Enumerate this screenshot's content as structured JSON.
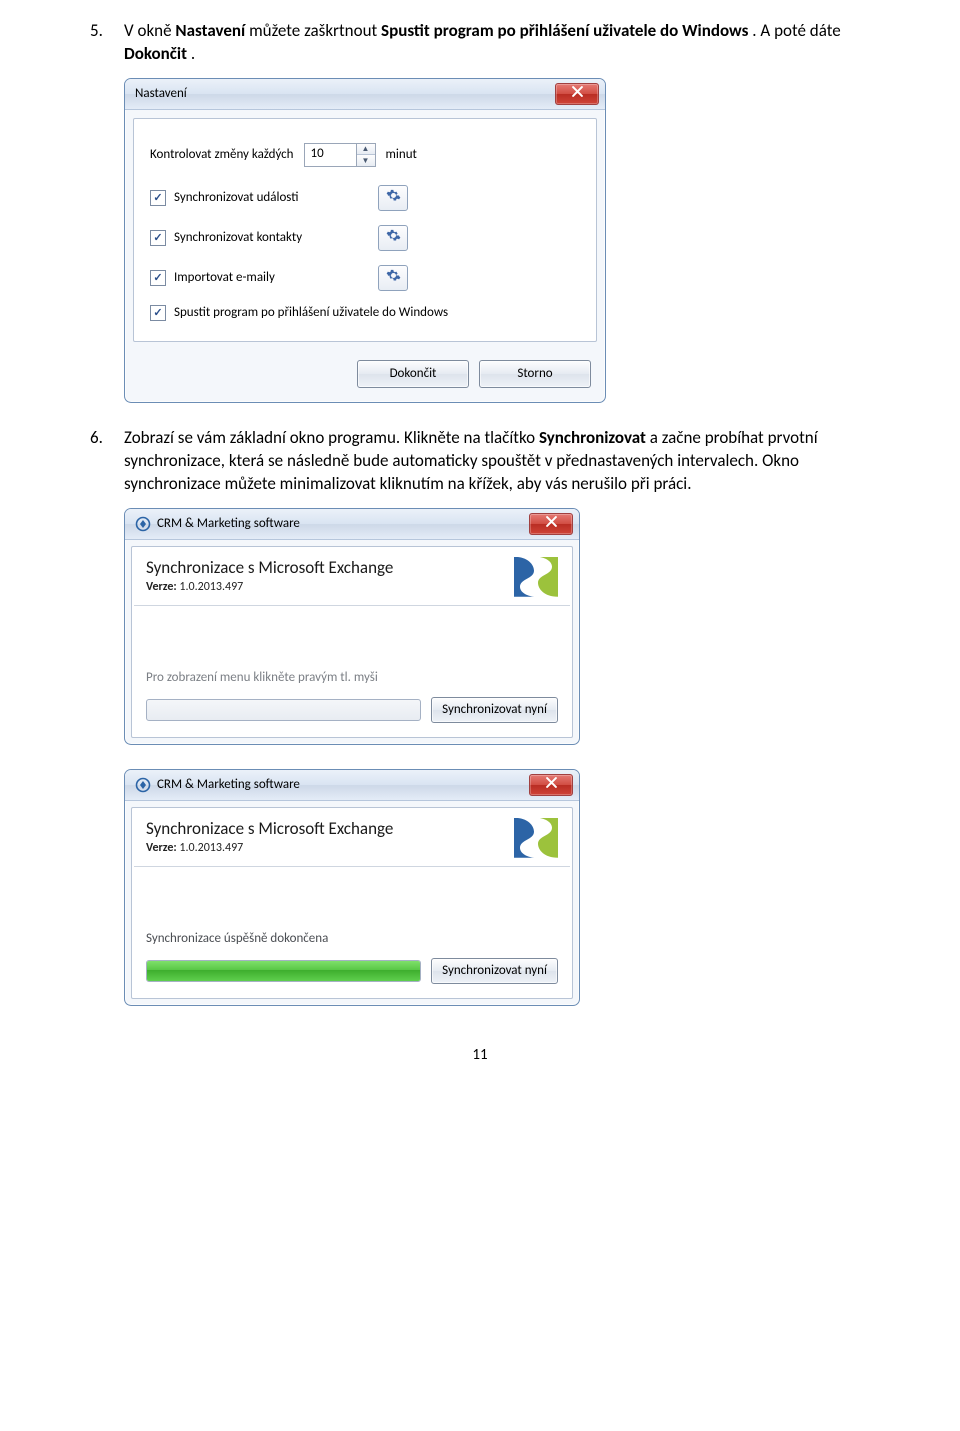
{
  "step5": {
    "num": "5.",
    "prefix": "V okně ",
    "bold1": "Nastavení",
    "mid": " můžete zaškrtnout ",
    "bold2": "Spustit program po přihlášení uživatele do Windows",
    "suffix1": ". A poté dáte ",
    "bold3": "Dokončit",
    "suffix2": "."
  },
  "dlg1": {
    "title": "Nastavení",
    "interval_prefix": "Kontrolovat změny každých",
    "interval_value": "10",
    "interval_suffix": "minut",
    "chk1": "Synchronizovat události",
    "chk2": "Synchronizovat kontakty",
    "chk3": "Importovat e-maily",
    "chk4": "Spustit program po přihlášení uživatele do Windows",
    "btn_finish": "Dokončit",
    "btn_cancel": "Storno"
  },
  "step6": {
    "num": "6.",
    "t1": "Zobrazí se vám základní okno programu. Klikněte na tlačítko ",
    "bold1": "Synchronizovat",
    "t2": " a začne probíhat prvotní synchronizace, která se následně bude automaticky spouštět v přednastavených intervalech. Okno synchronizace můžete minimalizovat kliknutím na křížek, aby vás nerušilo při práci."
  },
  "sync": {
    "app_title": "CRM & Marketing software",
    "heading": "Synchronizace s Microsoft Exchange",
    "ver_label": "Verze:",
    "ver_value": " 1.0.2013.497",
    "status_idle": "Pro zobrazení menu klikněte pravým tl. myši",
    "status_done": "Synchronizace úspěšně dokončena",
    "btn_sync": "Synchronizovat nyní"
  },
  "pagenum": "11"
}
